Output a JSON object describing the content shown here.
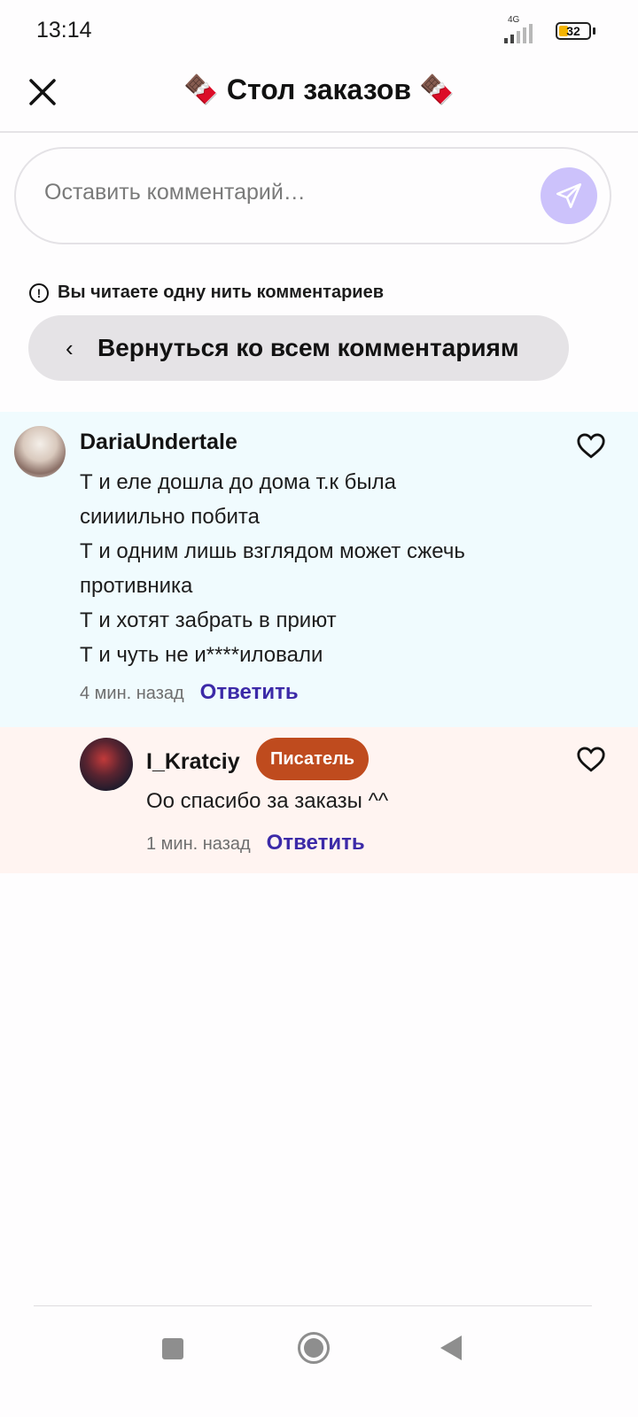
{
  "status_bar": {
    "time": "13:14",
    "network": "4G",
    "battery": "32"
  },
  "header": {
    "title": "🍫 Стол заказов 🍫",
    "close_icon": "close-icon"
  },
  "comment_box": {
    "placeholder": "Оставить комментарий…",
    "send_icon": "send-icon"
  },
  "thread": {
    "notice": "Вы читаете одну нить комментариев",
    "back_button_label": "Вернуться ко всем комментариям"
  },
  "comments": [
    {
      "username": "DariaUndertale",
      "lines": [
        "Т и еле дошла до дома т.к была",
        "сиииильно побита",
        "Т и одним лишь взглядом может сжечь",
        "противника",
        "Т и хотят забрать в приют",
        "Т и чуть не и****иловали"
      ],
      "timestamp": "4 мин. назад",
      "reply_label": "Ответить"
    },
    {
      "username": "I_Kratciy",
      "badge": "Писатель",
      "text": "Оо спасибо за заказы ^^",
      "timestamp": "1 мин. назад",
      "reply_label": "Ответить"
    }
  ],
  "colors": {
    "accent": "#3c2aa8",
    "send_button": "#ccc2fb",
    "badge": "#bf4b1e",
    "comment1_bg": "#f0fbfe",
    "comment2_bg": "#fff4f1"
  }
}
